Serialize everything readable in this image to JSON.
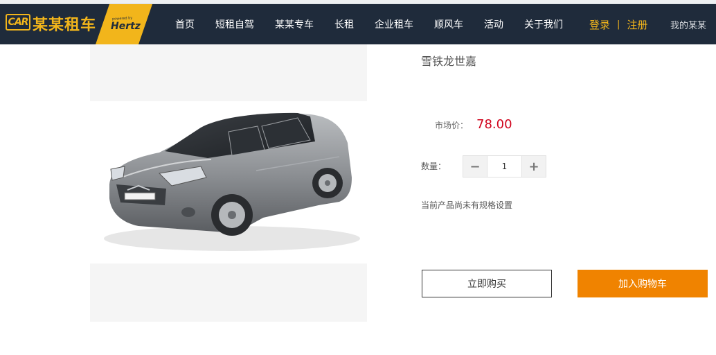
{
  "brand": {
    "logo_mark": "CAR",
    "name": "某某租车",
    "partner_tagline": "powered by",
    "partner_name": "Hertz",
    "accent_color": "#f2b51b",
    "header_bg": "#1f2b3b"
  },
  "nav": {
    "items": [
      "首页",
      "短租自驾",
      "某某专车",
      "长租",
      "企业租车",
      "顺风车",
      "活动",
      "关于我们"
    ]
  },
  "auth": {
    "login": "登录",
    "separator": "|",
    "register": "注册",
    "my_account": "我的某某"
  },
  "product": {
    "title": "雪铁龙世嘉",
    "price_label": "市场价：",
    "price_value": "78.00",
    "price_color": "#d0021b",
    "quantity_label": "数量：",
    "quantity_value": "1",
    "decrement_symbol": "−",
    "increment_symbol": "+",
    "spec_note": "当前产品尚未有规格设置",
    "image_icon": "car-photo"
  },
  "actions": {
    "buy_now": "立即购买",
    "add_to_cart": "加入购物车",
    "add_to_cart_color": "#f08300"
  }
}
